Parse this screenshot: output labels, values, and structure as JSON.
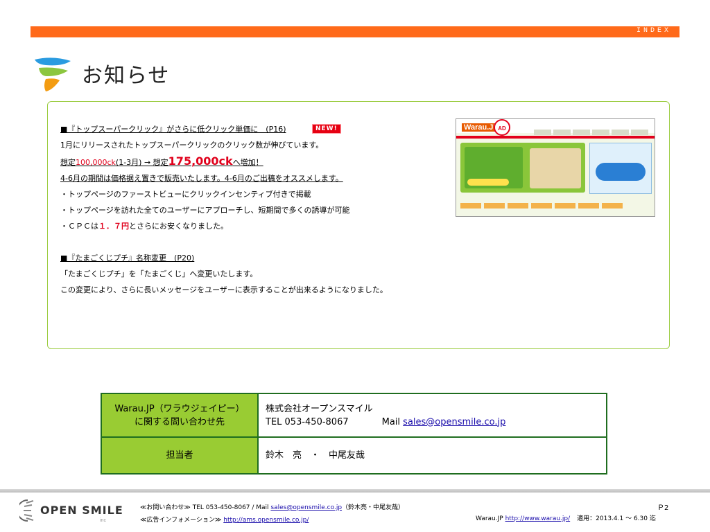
{
  "header": {
    "index_label": "INDEX"
  },
  "title": {
    "text": "お知らせ"
  },
  "notice": {
    "sec1_heading": "■『トップスーパークリック』がさらに低クリック単価に　(P16)",
    "new_badge": "NEW!",
    "sec1_line1": "1月にリリースされたトップスーパークリックのクリック数が伸びています。",
    "sec1_line2_a": "想定",
    "sec1_line2_b": "100,000ck",
    "sec1_line2_c": "(1-3月) → 想定",
    "sec1_line2_d": "175,000ck",
    "sec1_line2_e": "へ増加！",
    "sec1_line3": "4-6月の期間は価格据え置きで販売いたします。4-6月のご出稿をオススメします。",
    "sec1_bullet1": "・トップページのファーストビューにクリックインセンティブ付きで掲載",
    "sec1_bullet2": "・トップページを訪れた全てのユーザーにアプローチし、短期間で多くの誘導が可能",
    "sec1_bullet3_a": "・ＣＰＣは",
    "sec1_bullet3_b": "１．７円",
    "sec1_bullet3_c": "とさらにお安くなりました。",
    "sec2_heading": "■『たまごくじプチ』名称変更　(P20)",
    "sec2_line1": "「たまごくじプチ」を「たまごくじ」へ変更いたします。",
    "sec2_line2": "この変更により、さらに長いメッセージをユーザーに表示することが出来るようになりました。"
  },
  "screenshot": {
    "brand": "Warau.JP",
    "ad_label": "AD"
  },
  "contact": {
    "label1_line1": "Warau.JP（ワラウジェイピー）",
    "label1_line2": "に関する問い合わせ先",
    "company": "株式会社オープンスマイル",
    "tel": "TEL 053-450-8067",
    "mail_label": "Mail ",
    "mail": "sales@opensmile.co.jp",
    "label2": "担当者",
    "persons": "鈴木　亮　・　中尾友哉"
  },
  "footer": {
    "logo_text": "OPEN SMILE",
    "logo_inc": "inc",
    "inquiry_prefix": "≪お問い合わせ≫ TEL 053-450-8067 / Mail ",
    "inquiry_mail": "sales@opensmile.co.jp",
    "inquiry_suffix": "（鈴木亮・中尾友哉）",
    "ad_info_prefix": "≪広告インフォメーション≫ ",
    "ad_info_url": "http://ams.opensmile.co.jp/",
    "page": "Ｐ2",
    "site_prefix": "Warau.JP ",
    "site_url": "http://www.warau.jp/",
    "period": "適用：2013.4.1 ～ 6.30 迄"
  },
  "colors": {
    "accent_orange": "#ff6a1a",
    "box_green": "#9ccd42",
    "table_green": "#99cc33",
    "highlight_red": "#e0001b"
  }
}
